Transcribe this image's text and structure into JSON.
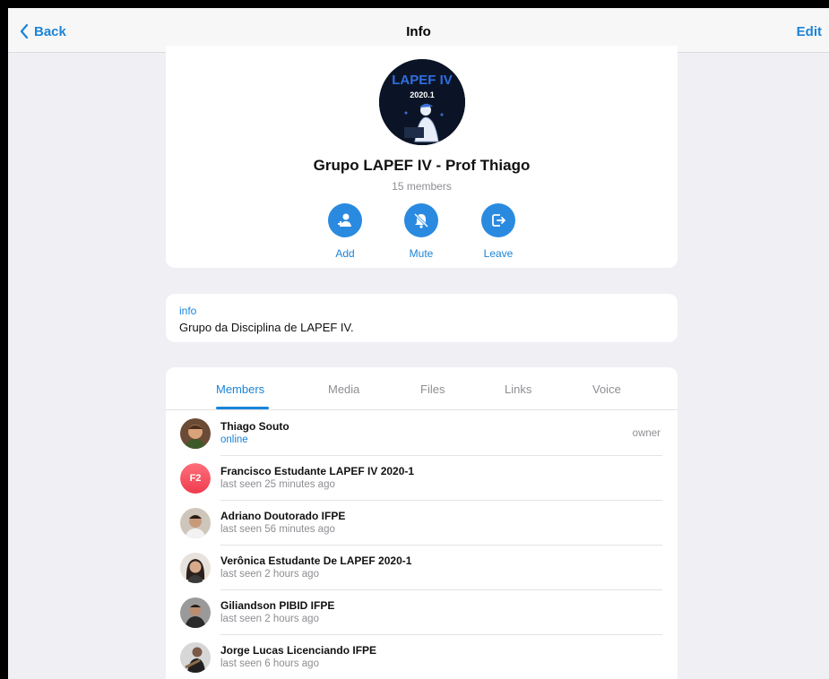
{
  "navbar": {
    "back_label": "Back",
    "title": "Info",
    "edit_label": "Edit"
  },
  "profile": {
    "avatar_line1": "LAPEF IV",
    "avatar_line2": "2020.1",
    "group_name": "Grupo LAPEF IV - Prof Thiago",
    "member_count": "15 members",
    "actions": [
      {
        "label": "Add",
        "icon": "add-user-icon"
      },
      {
        "label": "Mute",
        "icon": "bell-slash-icon"
      },
      {
        "label": "Leave",
        "icon": "leave-icon"
      }
    ]
  },
  "info": {
    "label": "info",
    "text": "Grupo da Disciplina de LAPEF IV."
  },
  "tabs": [
    "Members",
    "Media",
    "Files",
    "Links",
    "Voice"
  ],
  "members": [
    {
      "name": "Thiago Souto",
      "status": "online",
      "role": "owner"
    },
    {
      "name": "Francisco Estudante LAPEF IV 2020-1",
      "status": "last seen 25 minutes ago",
      "initials": "F2"
    },
    {
      "name": "Adriano Doutorado IFPE",
      "status": "last seen 56 minutes ago"
    },
    {
      "name": "Verônica Estudante De LAPEF 2020-1",
      "status": "last seen 2 hours ago"
    },
    {
      "name": "Giliandson PIBID IFPE",
      "status": "last seen 2 hours ago"
    },
    {
      "name": "Jorge Lucas Licenciando IFPE",
      "status": "last seen 6 hours ago"
    }
  ],
  "colors": {
    "accent": "#1a84d8",
    "action_bg": "#2a8ae0",
    "background": "#efeff4"
  }
}
